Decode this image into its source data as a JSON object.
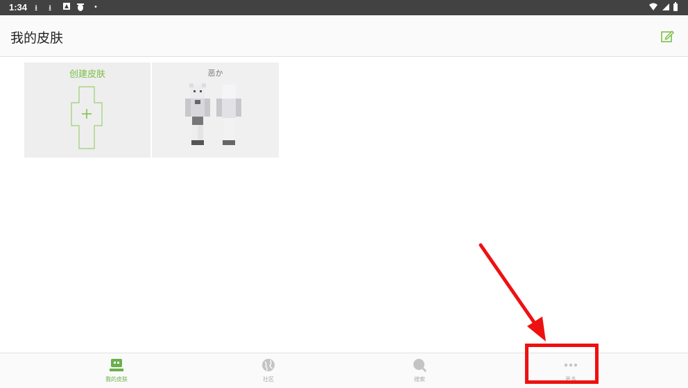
{
  "status": {
    "time": "1:34"
  },
  "appbar": {
    "title": "我的皮肤"
  },
  "skins": {
    "create_label": "创建皮肤",
    "skin_name": "恶か"
  },
  "nav": [
    {
      "label": "我的皮肤",
      "icon": "robot-icon",
      "active": true
    },
    {
      "label": "社区",
      "icon": "globe-icon",
      "active": false
    },
    {
      "label": "搜索",
      "icon": "search-icon",
      "active": false
    },
    {
      "label": "更多",
      "icon": "more-icon",
      "active": false
    }
  ],
  "colors": {
    "accent": "#7cbf47",
    "annotation": "#ee1111"
  }
}
